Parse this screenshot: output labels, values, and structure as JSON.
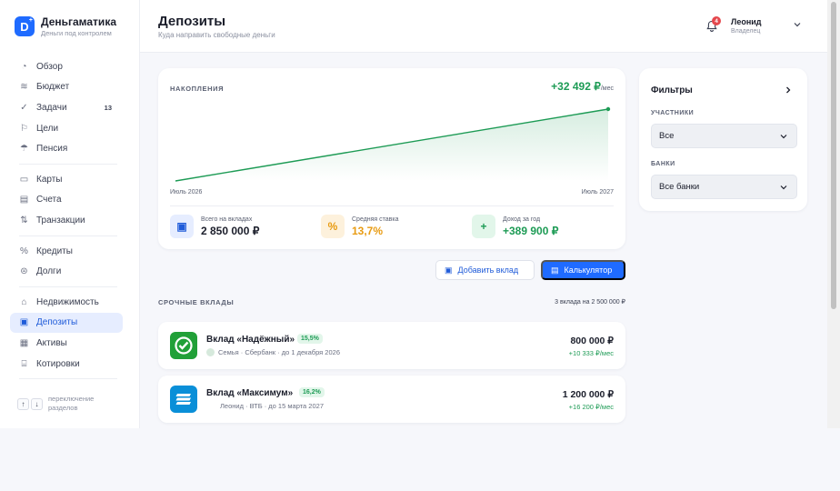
{
  "brand": {
    "name": "Деньгаматика",
    "sub": "Деньги под контролем",
    "logo_letter": "D"
  },
  "nav": {
    "groups": [
      [
        {
          "label": "Обзор",
          "icon": "pie-chart-icon"
        },
        {
          "label": "Бюджет",
          "icon": "waves-icon"
        },
        {
          "label": "Задачи",
          "icon": "check-circle-icon",
          "badge": "13"
        },
        {
          "label": "Цели",
          "icon": "flag-icon"
        },
        {
          "label": "Пенсия",
          "icon": "umbrella-icon"
        }
      ],
      [
        {
          "label": "Карты",
          "icon": "card-icon"
        },
        {
          "label": "Счета",
          "icon": "wallet-icon"
        },
        {
          "label": "Транзакции",
          "icon": "arrows-icon"
        }
      ],
      [
        {
          "label": "Кредиты",
          "icon": "percent-icon"
        },
        {
          "label": "Долги",
          "icon": "coins-icon"
        }
      ],
      [
        {
          "label": "Недвижимость",
          "icon": "home-icon"
        },
        {
          "label": "Депозиты",
          "icon": "safe-icon",
          "active": true
        },
        {
          "label": "Активы",
          "icon": "briefcase-icon"
        },
        {
          "label": "Котировки",
          "icon": "bank-icon"
        }
      ]
    ]
  },
  "hint": {
    "text": "переключение разделов",
    "keys": [
      "↑",
      "↓"
    ]
  },
  "header": {
    "title": "Депозиты",
    "subtitle": "Куда направить свободные деньги"
  },
  "user": {
    "name": "Леонид",
    "role": "Владелец",
    "notifications": "4"
  },
  "savings": {
    "label": "НАКОПЛЕНИЯ",
    "amount": "+32 492 ₽",
    "per": "/мес",
    "axis_start": "Июль 2026",
    "axis_end": "Июль 2027",
    "stats": [
      {
        "label": "Всего на вкладах",
        "value": "2 850 000 ₽",
        "icon": "safe-icon",
        "color": "#1b1e2b"
      },
      {
        "label": "Средняя ставка",
        "value": "13,7%",
        "icon": "percent-icon",
        "color": "#e89b12"
      },
      {
        "label": "Доход за год",
        "value": "+389 900 ₽",
        "icon": "plus-icon",
        "color": "#1d9b55"
      }
    ]
  },
  "chart_data": {
    "type": "area",
    "x": [
      "Июль 2026",
      "Июль 2027"
    ],
    "series": [
      {
        "values": [
          0,
          389900
        ]
      }
    ],
    "color": "#1d9b55"
  },
  "actions": {
    "add_label": "Добавить вклад",
    "calc_label": "Калькулятор"
  },
  "deposits": {
    "section_label": "СРОЧНЫЕ ВКЛАДЫ",
    "count_label": "3 вклада на 2 500 000 ₽",
    "items": [
      {
        "name": "Вклад «Надёжный»",
        "rate": "15,5%",
        "meta": "Семья · Сбербанк · до 1 декабря 2026",
        "amount": "800 000 ₽",
        "income": "+10 333 ₽/мес",
        "logo_color": "#21a038"
      },
      {
        "name": "Вклад «Максимум»",
        "rate": "16,2%",
        "meta": "Леонид · ВТБ · до 15 марта 2027",
        "amount": "1 200 000 ₽",
        "income": "+16 200 ₽/мес",
        "logo_color": "#0a8fd8"
      }
    ]
  },
  "filters": {
    "title": "Фильтры",
    "participants_label": "УЧАСТНИКИ",
    "participants_value": "Все",
    "banks_label": "БАНКИ",
    "banks_value": "Все банки"
  }
}
